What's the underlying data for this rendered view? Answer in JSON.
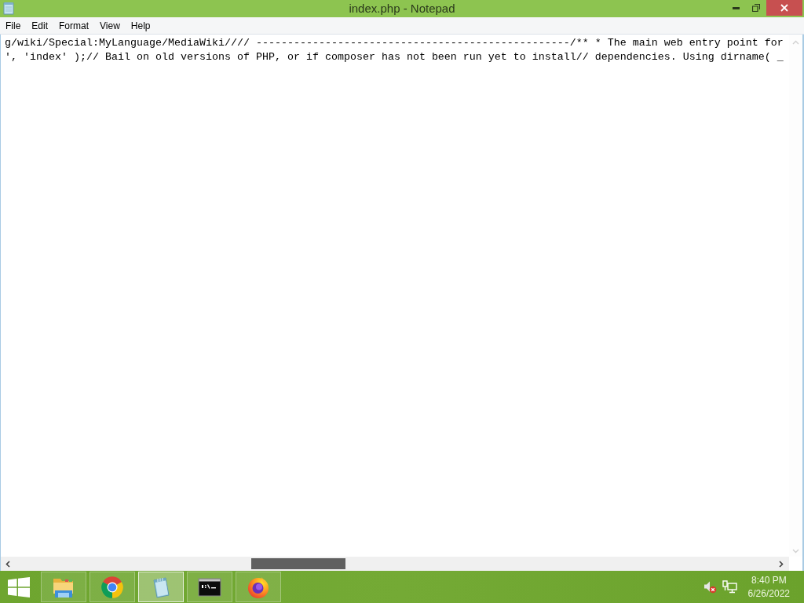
{
  "window": {
    "title": "index.php - Notepad",
    "menu": [
      "File",
      "Edit",
      "Format",
      "View",
      "Help"
    ]
  },
  "editor": {
    "lines": [
      "g/wiki/Special:MyLanguage/MediaWiki//// --------------------------------------------------/** * The main web entry point for",
      "', 'index' );// Bail on old versions of PHP, or if composer has not been run yet to install// dependencies. Using dirname( _"
    ]
  },
  "taskbar": {
    "apps": [
      {
        "kind": "explorer",
        "active": false
      },
      {
        "kind": "chrome",
        "active": false
      },
      {
        "kind": "notepad",
        "active": true
      },
      {
        "kind": "terminal",
        "active": false
      },
      {
        "kind": "firefox",
        "active": false
      }
    ],
    "tray": {
      "volume_muted": true
    },
    "clock": {
      "time": "8:40 PM",
      "date": "6/26/2022"
    }
  }
}
